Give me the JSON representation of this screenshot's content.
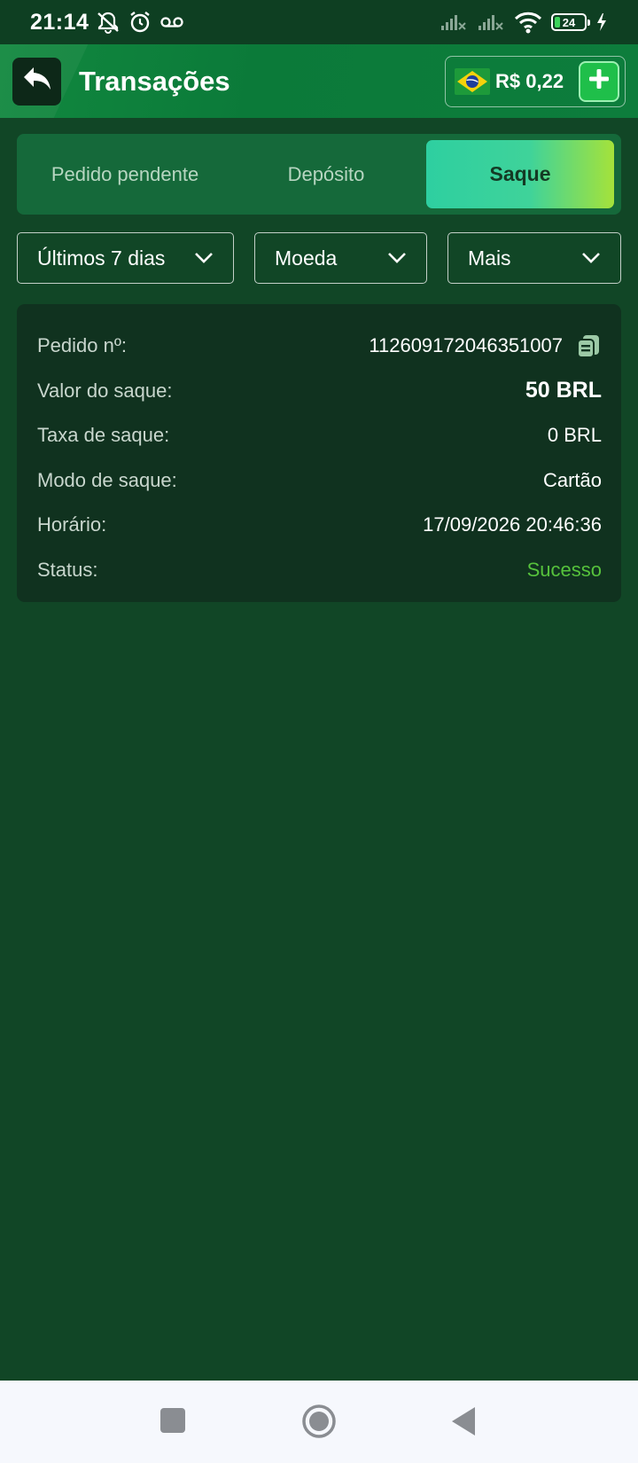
{
  "status_bar": {
    "time": "21:14",
    "battery": "24",
    "icons": [
      "muted-bell-icon",
      "alarm-icon",
      "voicemail-icon",
      "signal-off-icon",
      "signal-off-icon",
      "wifi-icon",
      "battery-icon",
      "charging-icon"
    ]
  },
  "header": {
    "title": "Transações",
    "balance": "R$ 0,22",
    "back_icon": "reply-arrow-icon",
    "flag_icon": "brazil-flag-icon",
    "add_icon": "plus-icon"
  },
  "tabs": [
    {
      "label": "Pedido pendente",
      "active": false
    },
    {
      "label": "Depósito",
      "active": false
    },
    {
      "label": "Saque",
      "active": true
    }
  ],
  "filters": {
    "period": "Últimos 7 dias",
    "currency": "Moeda",
    "more": "Mais"
  },
  "transaction": {
    "order_label": "Pedido nº:",
    "order_value": "112609172046351007",
    "amount_label": "Valor do saque:",
    "amount_value": "50 BRL",
    "fee_label": "Taxa de saque:",
    "fee_value": "0 BRL",
    "mode_label": "Modo de saque:",
    "mode_value": "Cartão",
    "time_label": "Horário:",
    "time_value": "17/09/2026 20:46:36",
    "status_label": "Status:",
    "status_value": "Sucesso"
  },
  "colors": {
    "background": "#114626",
    "header": "#0b7a39",
    "card": "#10321f",
    "success": "#56c23c",
    "tab_active_start": "#2ecfa0",
    "tab_active_end": "#a5e23a"
  }
}
